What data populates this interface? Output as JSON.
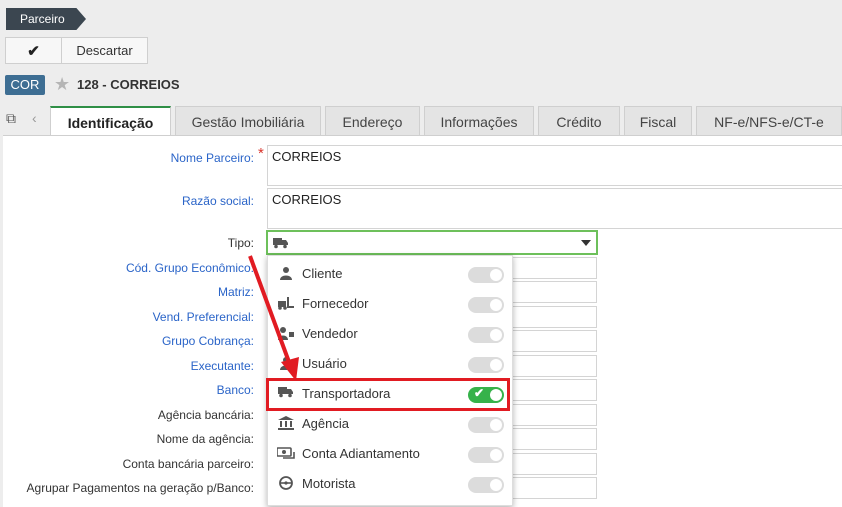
{
  "breadcrumb": {
    "label": "Parceiro"
  },
  "toolbar": {
    "confirm_icon": "check-icon",
    "discard_label": "Descartar"
  },
  "record": {
    "badge": "COR",
    "title": "128 - CORREIOS",
    "favorite_icon": "star-icon"
  },
  "tabs": [
    {
      "label": "Identificação",
      "active": true
    },
    {
      "label": "Gestão Imobiliária"
    },
    {
      "label": "Endereço"
    },
    {
      "label": "Informações"
    },
    {
      "label": "Crédito"
    },
    {
      "label": "Fiscal"
    },
    {
      "label": "NF-e/NFS-e/CT-e"
    }
  ],
  "form": {
    "nome_parceiro": {
      "label": "Nome Parceiro:",
      "value": "CORREIOS",
      "required": "*"
    },
    "razao_social": {
      "label": "Razão social:",
      "value": "CORREIOS"
    },
    "tipo": {
      "label": "Tipo:",
      "icon": "truck-icon"
    },
    "cod_grupo": {
      "label": "Cód. Grupo Econômico:"
    },
    "matriz": {
      "label": "Matriz:"
    },
    "vend_pref": {
      "label": "Vend. Preferencial:"
    },
    "grupo_cobranca": {
      "label": "Grupo Cobrança:"
    },
    "executante": {
      "label": "Executante:"
    },
    "banco": {
      "label": "Banco:"
    },
    "agencia_bancaria": {
      "label": "Agência bancária:"
    },
    "nome_agencia": {
      "label": "Nome da agência:"
    },
    "conta_bancaria": {
      "label": "Conta bancária parceiro:"
    },
    "agrupar": {
      "label": "Agrupar Pagamentos na geração p/Banco:"
    }
  },
  "tipo_dropdown": [
    {
      "label": "Cliente",
      "icon": "person-icon",
      "on": false
    },
    {
      "label": "Fornecedor",
      "icon": "forklift-icon",
      "on": false
    },
    {
      "label": "Vendedor",
      "icon": "salesperson-icon",
      "on": false
    },
    {
      "label": "Usuário",
      "icon": "user-icon",
      "on": false
    },
    {
      "label": "Transportadora",
      "icon": "truck-icon",
      "on": true
    },
    {
      "label": "Agência",
      "icon": "bank-icon",
      "on": false
    },
    {
      "label": "Conta Adiantamento",
      "icon": "money-icon",
      "on": false
    },
    {
      "label": "Motorista",
      "icon": "steering-wheel-icon",
      "on": false
    }
  ],
  "colors": {
    "accent_green": "#36b24a",
    "annotation_red": "#e11b22",
    "label_blue": "#2a64c8"
  }
}
